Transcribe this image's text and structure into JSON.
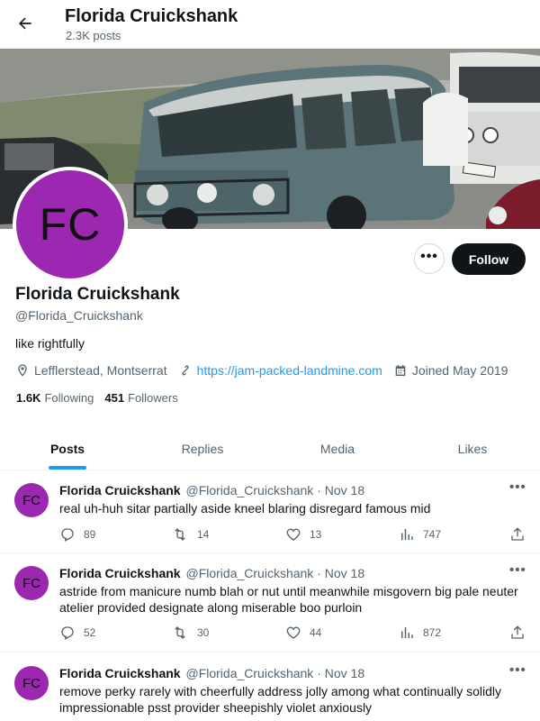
{
  "header": {
    "name": "Florida Cruickshank",
    "posts_count": "2.3K posts"
  },
  "profile": {
    "avatar_initials": "FC",
    "display_name": "Florida Cruickshank",
    "handle": "@Florida_Cruickshank",
    "bio": "like rightfully",
    "location": "Lefflerstead, Montserrat",
    "website": "https://jam-packed-landmine.com",
    "joined": "Joined May 2019",
    "following_count": "1.6K",
    "following_label": "Following",
    "followers_count": "451",
    "followers_label": "Followers",
    "more_label": "•••",
    "follow_label": "Follow"
  },
  "tabs": [
    {
      "label": "Posts",
      "active": true
    },
    {
      "label": "Replies",
      "active": false
    },
    {
      "label": "Media",
      "active": false
    },
    {
      "label": "Likes",
      "active": false
    }
  ],
  "posts": [
    {
      "avatar_initials": "FC",
      "author": "Florida Cruickshank",
      "meta": "@Florida_Cruickshank · Nov 18",
      "text": "real uh-huh sitar partially aside kneel blaring disregard famous mid",
      "replies": "89",
      "reposts": "14",
      "likes": "13",
      "views": "747"
    },
    {
      "avatar_initials": "FC",
      "author": "Florida Cruickshank",
      "meta": "@Florida_Cruickshank · Nov 18",
      "text": "astride from manicure numb blah or nut until meanwhile misgovern big pale neuter atelier provided designate along miserable boo purloin",
      "replies": "52",
      "reposts": "30",
      "likes": "44",
      "views": "872"
    },
    {
      "avatar_initials": "FC",
      "author": "Florida Cruickshank",
      "meta": "@Florida_Cruickshank · Nov 18",
      "text": "remove perky rarely with cheerfully address jolly among what continually solidly impressionable psst provider sheepishly violet anxiously"
    }
  ],
  "post_menu_label": "•••",
  "colors": {
    "accent": "#1d9bf0",
    "avatar": "#9c27b0",
    "follow_button": "#0f1419"
  },
  "icons": [
    "back-arrow-icon",
    "location-icon",
    "link-icon",
    "calendar-icon",
    "reply-icon",
    "repost-icon",
    "like-icon",
    "views-icon",
    "share-icon"
  ]
}
